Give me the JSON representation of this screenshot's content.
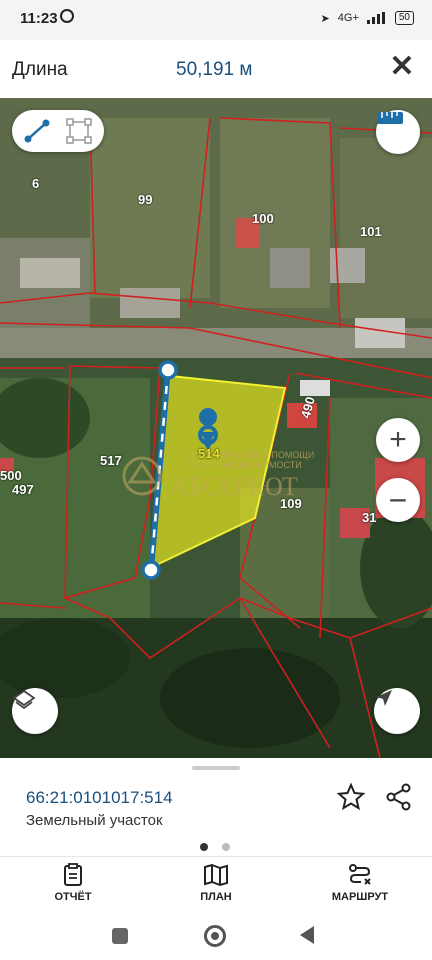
{
  "status_bar": {
    "time": "11:23",
    "network": "4G+",
    "battery": "50"
  },
  "header": {
    "label": "Длина",
    "value": "50,191 м"
  },
  "map": {
    "plot_labels": [
      "6",
      "99",
      "100",
      "101",
      "490",
      "517",
      "514",
      "500",
      "497",
      "109",
      "31"
    ],
    "watermark_line1": "ЦЕНТР ПРАВОВОЙ ПОМОЩИ",
    "watermark_line2": "ЦЕНТР НЕДВИЖИМОСТИ",
    "watermark_brand": "АБСОЛЮТ",
    "parcel_highlight_color": "#e6e620"
  },
  "info_panel": {
    "cadastral_number": "66:21:0101017:514",
    "type": "Земельный участок"
  },
  "bottom_nav": [
    {
      "label": "ОТЧЁТ"
    },
    {
      "label": "ПЛАН"
    },
    {
      "label": "МАРШРУТ"
    }
  ],
  "colors": {
    "accent": "#1a4f7e",
    "measure_line": "#1e6fa8",
    "cadastral_border": "#d02020"
  }
}
